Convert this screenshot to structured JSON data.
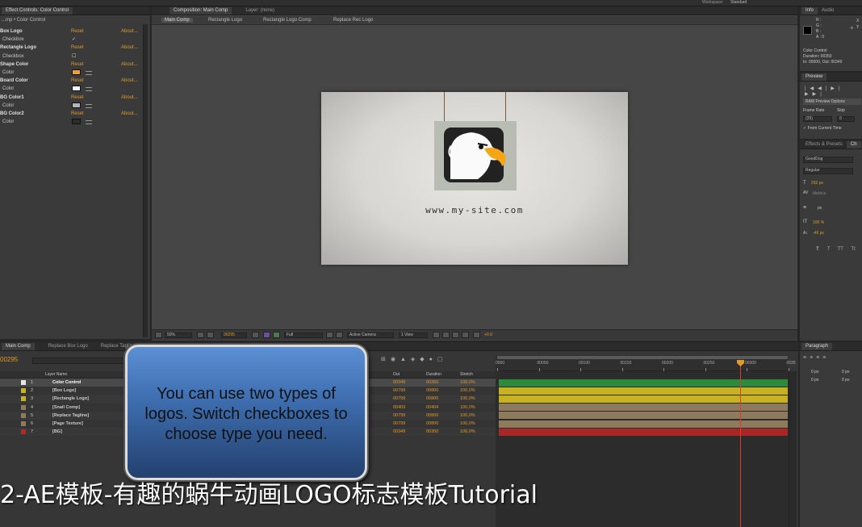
{
  "topbar": {
    "workspace_label": "Workspace:",
    "workspace_value": "Standard"
  },
  "effect_controls": {
    "tab_title": "Effect Controls: Color Control",
    "breadcrumb": "...mp • Color Control",
    "rows": [
      {
        "label": "Box Logo",
        "bold": true,
        "reset": "Reset",
        "about": "About..."
      },
      {
        "label": "Checkbox",
        "bold": false,
        "check": "✓"
      },
      {
        "label": "Rectangle Logo",
        "bold": true,
        "reset": "Reset",
        "about": "About..."
      },
      {
        "label": "Checkbox",
        "bold": false,
        "check": "☐"
      },
      {
        "label": "Shape Color",
        "bold": true,
        "reset": "Reset",
        "about": "About..."
      },
      {
        "label": "Color",
        "bold": false,
        "swatch": "#f0a030"
      },
      {
        "label": "Board Color",
        "bold": true,
        "reset": "Reset",
        "about": "About..."
      },
      {
        "label": "Color",
        "bold": false,
        "swatch": "#f5f5f5"
      },
      {
        "label": "BG Color1",
        "bold": true,
        "reset": "Reset",
        "about": "About..."
      },
      {
        "label": "Color",
        "bold": false,
        "swatch": "#b5b5b5"
      },
      {
        "label": "BG Color2",
        "bold": true,
        "reset": "Reset",
        "about": "About..."
      },
      {
        "label": "Color",
        "bold": false,
        "swatch": "#2c2c2c"
      }
    ]
  },
  "composition": {
    "tab_title": "Composition: Main Comp",
    "layer_tab": "Layer: (none)",
    "breadcrumbs": [
      "Main Comp",
      "Rectangle Logo",
      "Rectangle Logo Comp",
      "Replace Rec Logo"
    ],
    "website": "www.my-site.com",
    "toolbar": {
      "zoom": "50%",
      "timecode": "00295",
      "resolution": "Full",
      "camera": "Active Camera",
      "view": "1 View",
      "exposure": "+0.0"
    }
  },
  "info_panel": {
    "tabs": [
      "Info",
      "Audio"
    ],
    "rgba": [
      "R :",
      "G :",
      "B :",
      "A : 0"
    ],
    "xy": [
      "X",
      "Y"
    ],
    "lines": [
      "Color Control",
      "Duration: 00350",
      "In: 00000, Out: 00349"
    ]
  },
  "preview_panel": {
    "title": "Preview",
    "ram": "RAM Preview Options",
    "frame_rate_label": "Frame Rate",
    "skip_label": "Skip",
    "frame_rate": "(25)",
    "skip": "0",
    "from_current": "From Current Time"
  },
  "effects_panel": {
    "tabs": [
      "Effects & Presets",
      "Ch"
    ],
    "font": "GoodDog",
    "style": "Regular",
    "size": "292 px",
    "leading": "Metrics",
    "px": "px",
    "scale": "100 %",
    "baseline": "-46 px",
    "styles": [
      "T",
      "T",
      "TT",
      "Tt"
    ]
  },
  "paragraph_panel": {
    "title": "Paragraph",
    "values": [
      "0 px",
      "0 px",
      "0 px",
      "0 px",
      "0 px"
    ]
  },
  "timeline": {
    "tabs": [
      "Main Comp",
      "Replace Box Logo",
      "Replace Tagline"
    ],
    "timecode": "00295",
    "col_layer_name": "Layer Name",
    "col_out": "Out",
    "col_duration": "Duration",
    "col_stretch": "Stretch",
    "ruler": [
      "0000",
      "00050",
      "00100",
      "00150",
      "00200",
      "00250",
      "00300",
      "0035"
    ],
    "layers": [
      {
        "num": "1",
        "name": "Color Control",
        "label": "#e6e6e6",
        "out": "00349",
        "dur": "00350",
        "stretch": "100,0%",
        "bar": "#2d8a3a",
        "selected": true
      },
      {
        "num": "2",
        "name": "[Box Logo]",
        "label": "#c9b21f",
        "out": "00799",
        "dur": "00800",
        "stretch": "100,0%",
        "bar": "#c9b21f"
      },
      {
        "num": "3",
        "name": "[Rectangle Logo]",
        "label": "#c9b21f",
        "out": "00799",
        "dur": "00800",
        "stretch": "100,0%",
        "bar": "#c9b21f"
      },
      {
        "num": "4",
        "name": "[Snail Comp]",
        "label": "#8e7a5c",
        "out": "00403",
        "dur": "00404",
        "stretch": "100,0%",
        "bar": "#8e7a5c"
      },
      {
        "num": "5",
        "name": "[Replace Tagline]",
        "label": "#8e7a5c",
        "out": "00799",
        "dur": "00800",
        "stretch": "100,0%",
        "bar": "#8e7a5c"
      },
      {
        "num": "6",
        "name": "[Page Texture]",
        "label": "#8e7a5c",
        "out": "00799",
        "dur": "00800",
        "stretch": "100,0%",
        "bar": "#8e7a5c"
      },
      {
        "num": "7",
        "name": "[BG]",
        "label": "#b22a2a",
        "out": "00349",
        "dur": "00350",
        "stretch": "100,0%",
        "bar": "#a82626"
      }
    ]
  },
  "callout": {
    "text": "You can use two types of logos. Switch checkboxes to choose type you need."
  },
  "subtitle": {
    "text": "2-AE模板-有趣的蜗牛动画LOGO标志模板Tutorial"
  },
  "colors": {
    "accent": "#e09a2c",
    "callout_top": "#6f9cd6",
    "callout_bottom": "#24426f",
    "timeline_bar_green": "#2d8a3a"
  }
}
